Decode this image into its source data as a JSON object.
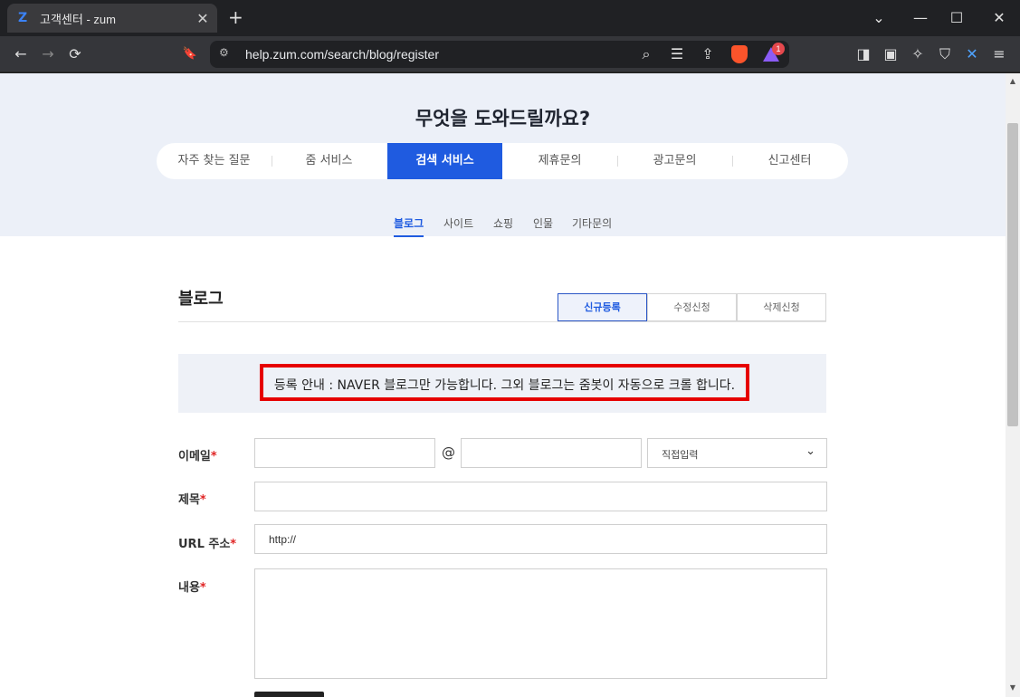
{
  "browser": {
    "tab_title": "고객센터 - zum",
    "tab_favicon": "Z",
    "new_tab": "+",
    "url": "help.zum.com/search/blog/register",
    "rewards_badge": "1",
    "icons": {
      "back": "←",
      "forward": "→",
      "reload": "⟳",
      "bookmark": "🔖",
      "zoom": "⌕",
      "reader": "☰",
      "share": "⇪",
      "sidebar": "◨",
      "wallet": "▣",
      "leo": "✧",
      "vpn": "⛉",
      "extension": "✕",
      "menu": "≡",
      "tabs_down": "⌄",
      "minimize": "—",
      "maximize": "☐",
      "close": "✕",
      "tab_close": "✕"
    }
  },
  "page": {
    "hero_title": "무엇을 도와드릴까요?",
    "main_nav": [
      {
        "label": "자주 찾는 질문",
        "active": false
      },
      {
        "label": "줌 서비스",
        "active": false
      },
      {
        "label": "검색 서비스",
        "active": true
      },
      {
        "label": "제휴문의",
        "active": false
      },
      {
        "label": "광고문의",
        "active": false
      },
      {
        "label": "신고센터",
        "active": false
      }
    ],
    "sub_nav": [
      {
        "label": "블로그",
        "active": true
      },
      {
        "label": "사이트",
        "active": false
      },
      {
        "label": "쇼핑",
        "active": false
      },
      {
        "label": "인물",
        "active": false
      },
      {
        "label": "기타문의",
        "active": false
      }
    ],
    "section_title": "블로그",
    "request_tabs": [
      {
        "label": "신규등록",
        "active": true
      },
      {
        "label": "수정신청",
        "active": false
      },
      {
        "label": "삭제신청",
        "active": false
      }
    ],
    "notice": "등록 안내 : NAVER 블로그만 가능합니다. 그외 블로그는 줌봇이 자동으로 크롤 합니다.",
    "form": {
      "required_mark": "*",
      "email_label": "이메일",
      "email_at": "@",
      "email_domain_select": "직접입력",
      "title_label": "제목",
      "url_label": "URL 주소",
      "url_value": "http://",
      "content_label": "내용"
    }
  },
  "colors": {
    "accent": "#1f5be0",
    "notice_border": "#e60000",
    "hero_bg": "#ecf0f8"
  }
}
